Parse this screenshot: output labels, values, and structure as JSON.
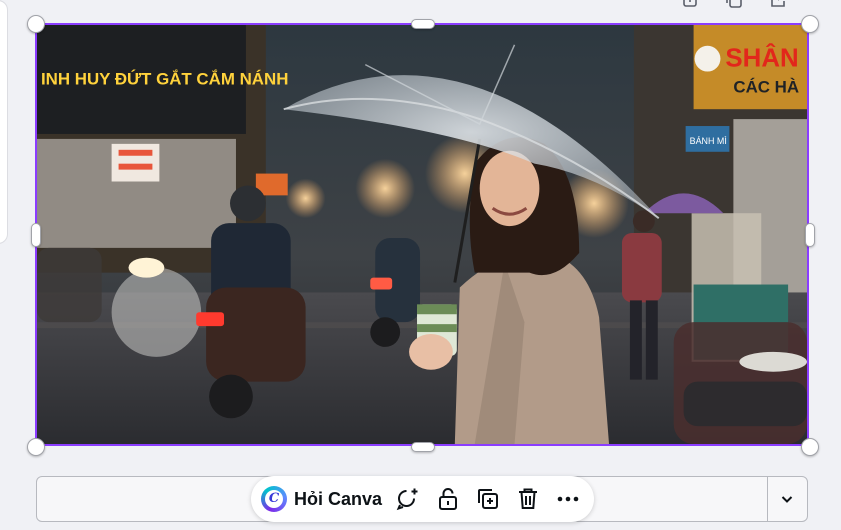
{
  "canvas": {
    "image": {
      "description_icon": "photo",
      "selection_color": "#8b3dff",
      "signs": {
        "left_sign": "INH HUY ĐỨT GẮT CẮM NÁNH",
        "right_sign_line1": "SHÂN B",
        "right_sign_line2": "CÁC HÀ",
        "small_sign": "BÁNH MÌ"
      }
    }
  },
  "top_tools": {
    "icons": [
      "lock-icon",
      "duplicate-icon",
      "share-icon"
    ]
  },
  "context_menu": {
    "ask_label": "Hỏi Canva",
    "logo_letter": "C",
    "icons": [
      "comment-add-icon",
      "lock-icon",
      "duplicate-icon",
      "trash-icon",
      "more-icon"
    ]
  },
  "bottom_bar": {
    "expand_icon": "chevron-down-icon"
  }
}
